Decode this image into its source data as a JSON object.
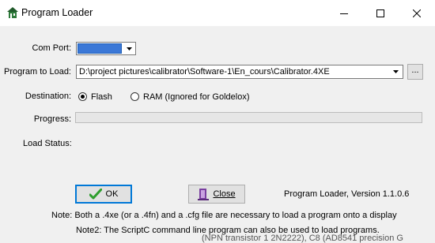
{
  "window": {
    "title": "Program Loader"
  },
  "form": {
    "com_port_label": "Com Port:",
    "com_port_value": "",
    "program_label": "Program to Load:",
    "program_path": "D:\\project pictures\\calibrator\\Software-1\\En_cours\\Calibrator.4XE",
    "browse_label": "...",
    "destination_label": "Destination:",
    "dest_flash_label": "Flash",
    "dest_ram_label": "RAM (Ignored for Goldelox)",
    "dest_selected": "Flash",
    "progress_label": "Progress:",
    "progress_value": 0,
    "load_status_label": "Load Status:",
    "load_status_value": ""
  },
  "buttons": {
    "ok_label": "OK",
    "close_label": "Close"
  },
  "footer": {
    "version": "Program Loader, Version 1.1.0.6",
    "note1": "Note: Both a .4xe (or a .4fn) and a .cfg file are necessary to load a program onto a display",
    "note2": "Note2: The ScriptC command line program can also be used to load programs.",
    "background_text": "(NPN transistor 1 2N2222), C8 (AD8541 precision G"
  },
  "colors": {
    "selection": "#3b78d7",
    "ok_check": "#2e9e2e",
    "default_button_border": "#0078d7"
  }
}
